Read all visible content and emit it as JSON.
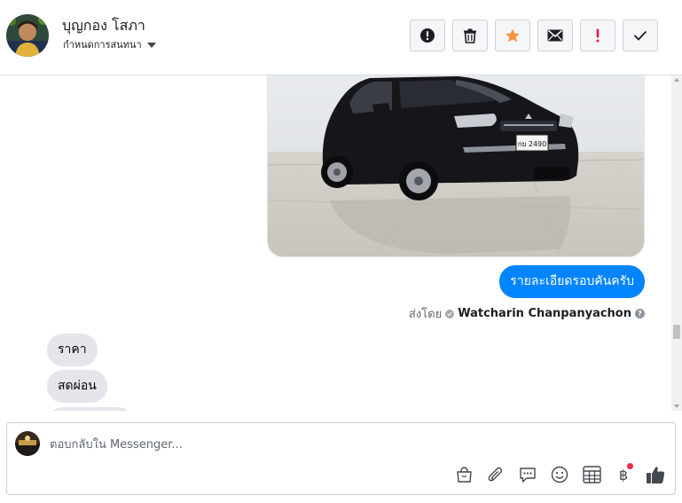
{
  "header": {
    "contact_name": "บุญกอง โสภา",
    "assign_label": "กำหนดการสนทนา",
    "actions": [
      {
        "name": "spam-button",
        "icon": "exclamation-circle-icon"
      },
      {
        "name": "delete-button",
        "icon": "trash-icon"
      },
      {
        "name": "star-button",
        "icon": "star-icon",
        "color": "#f7923a"
      },
      {
        "name": "mark-unread-button",
        "icon": "envelope-icon"
      },
      {
        "name": "follow-up-button",
        "icon": "exclamation-icon",
        "color": "#e41e3f"
      },
      {
        "name": "mark-done-button",
        "icon": "check-icon"
      }
    ]
  },
  "thread": {
    "image_plate_text": "กย 2490",
    "outgoing_message": "รายละเอียดรอบคันครับ",
    "sent_by_prefix": "ส่งโดย",
    "sent_by_name": "Watcharin Chanpanyachon",
    "help_glyph": "?",
    "incoming_messages": [
      "ราคา",
      "สดผ่อน",
      ""
    ]
  },
  "composer": {
    "placeholder": "ตอบกลับใน Messenger...",
    "tools": [
      "shop-icon",
      "attachment-icon",
      "saved-reply-icon",
      "emoji-icon",
      "appointment-icon",
      "payment-icon",
      "like-icon"
    ],
    "payment_glyph": "฿"
  },
  "colors": {
    "accent": "#0084ff",
    "incoming_bubble": "#e4e6eb",
    "star": "#f7923a",
    "alert": "#e41e3f",
    "notification_dot": "#f02849"
  }
}
